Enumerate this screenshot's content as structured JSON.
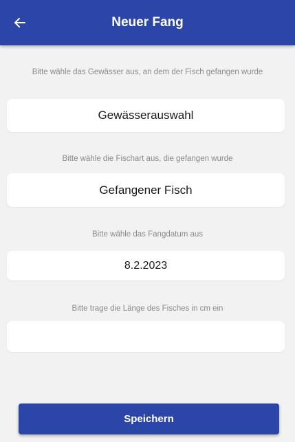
{
  "appbar": {
    "title": "Neuer Fang",
    "back_icon": "arrow-left-icon",
    "background_color": "#2b46a8"
  },
  "form": {
    "water": {
      "prompt": "Bitte wähle das Gewässer aus, an dem der Fisch gefangen wurde",
      "value": "Gewässerauswahl"
    },
    "fish": {
      "prompt": "Bitte wähle die Fischart aus, die gefangen wurde",
      "value": "Gefangener Fisch"
    },
    "date": {
      "prompt": "Bitte wähle das Fangdatum aus",
      "value": "8.2.2023"
    },
    "length": {
      "prompt": "Bitte trage die Länge des Fisches in cm ein",
      "value": "",
      "placeholder": ""
    }
  },
  "actions": {
    "save_label": "Speichern"
  }
}
